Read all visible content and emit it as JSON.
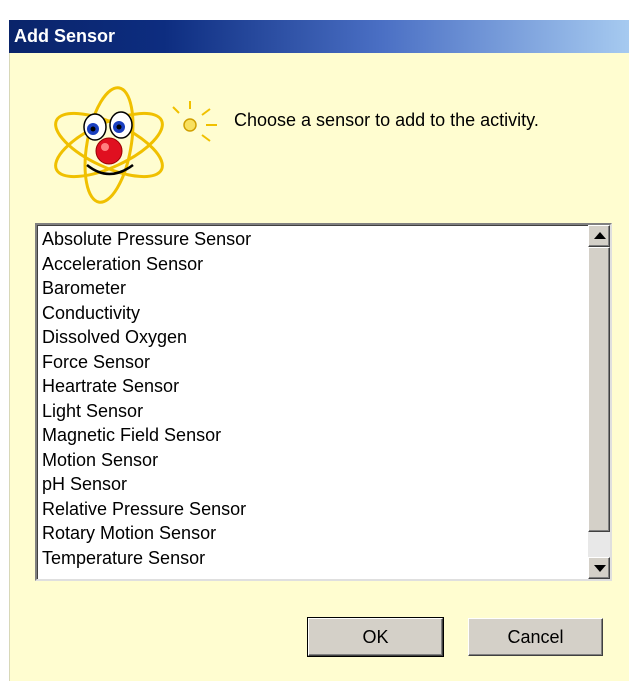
{
  "window": {
    "title": "Add Sensor"
  },
  "prompt": "Choose a sensor to add to the activity.",
  "sensor_list": {
    "items": [
      "Absolute Pressure Sensor",
      "Acceleration Sensor",
      "Barometer",
      "Conductivity",
      "Dissolved Oxygen",
      "Force Sensor",
      "Heartrate Sensor",
      "Light Sensor",
      "Magnetic Field Sensor",
      "Motion Sensor",
      "pH Sensor",
      "Relative Pressure Sensor",
      "Rotary Motion Sensor",
      "Temperature Sensor"
    ]
  },
  "buttons": {
    "ok_label": "OK",
    "cancel_label": "Cancel"
  },
  "icons": {
    "mascot": "atom-mascot-icon",
    "scroll_up": "scroll-up-arrow-icon",
    "scroll_down": "scroll-down-arrow-icon"
  },
  "colors": {
    "title_gradient_start": "#0a246a",
    "title_gradient_end": "#a6caf0",
    "client_background": "#fffdd0",
    "button_face": "#d4d0c8"
  }
}
